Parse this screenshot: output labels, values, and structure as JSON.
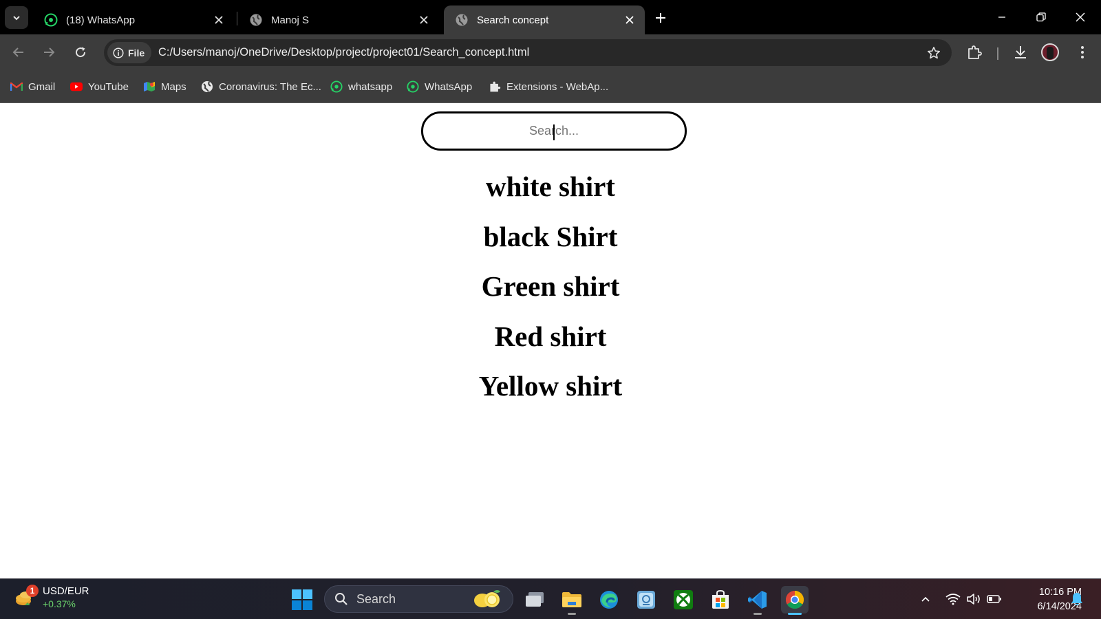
{
  "browser": {
    "tabs": [
      {
        "title": "(18) WhatsApp",
        "icon": "whatsapp-icon"
      },
      {
        "title": "Manoj S",
        "icon": "globe-icon"
      },
      {
        "title": "Search concept",
        "icon": "globe-icon",
        "active": true
      }
    ],
    "address_chip": "File",
    "url": "C:/Users/manoj/OneDrive/Desktop/project/project01/Search_concept.html",
    "bookmarks": [
      {
        "label": "Gmail",
        "icon": "gmail-icon"
      },
      {
        "label": "YouTube",
        "icon": "youtube-icon"
      },
      {
        "label": "Maps",
        "icon": "maps-icon"
      },
      {
        "label": "Coronavirus: The Ec...",
        "icon": "globe-icon"
      },
      {
        "label": "whatsapp",
        "icon": "whatsapp-icon"
      },
      {
        "label": "WhatsApp",
        "icon": "whatsapp-icon"
      },
      {
        "label": "Extensions - WebAp...",
        "icon": "puzzle-icon"
      }
    ]
  },
  "page": {
    "search_placeholder": "Search...",
    "items": [
      "white shirt",
      "black Shirt",
      "Green shirt",
      "Red shirt",
      "Yellow shirt"
    ]
  },
  "taskbar": {
    "widget": {
      "badge": "1",
      "pair": "USD/EUR",
      "change": "+0.37%"
    },
    "search_label": "Search",
    "time": "10:16 PM",
    "date": "6/14/2024"
  },
  "colors": {
    "accent": "#4cc2ff",
    "tab_bar": "#000000",
    "toolbar": "#3c3c3c",
    "whatsapp": "#25d366",
    "change_positive": "#6cd46c"
  }
}
